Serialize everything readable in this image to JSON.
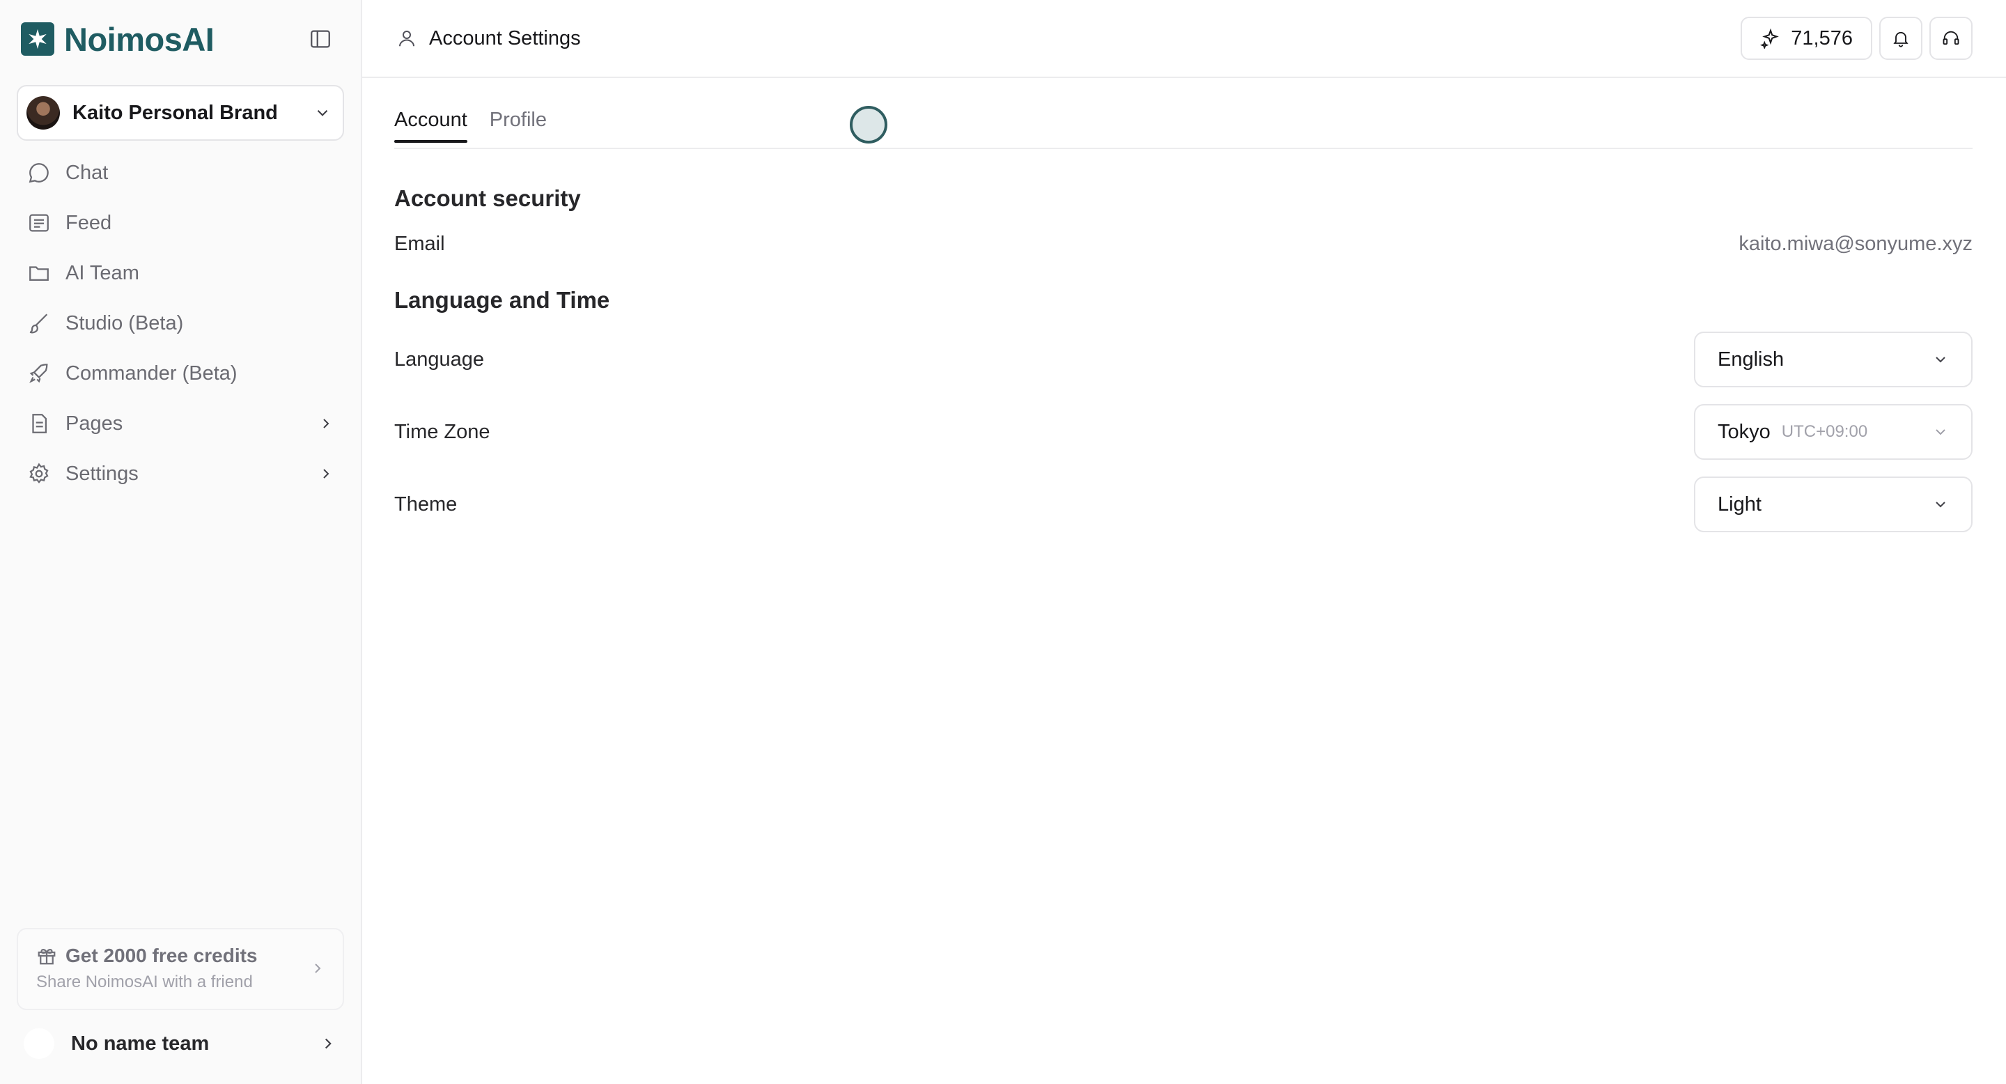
{
  "app": {
    "name": "NoimosAI"
  },
  "sidebar": {
    "workspace": {
      "name": "Kaito Personal Brand"
    },
    "items": [
      {
        "label": "Chat",
        "icon": "chat-bubble-icon"
      },
      {
        "label": "Feed",
        "icon": "list-icon"
      },
      {
        "label": "AI Team",
        "icon": "folder-icon"
      },
      {
        "label": "Studio (Beta)",
        "icon": "brush-icon"
      },
      {
        "label": "Commander (Beta)",
        "icon": "rocket-icon"
      },
      {
        "label": "Pages",
        "icon": "document-icon"
      },
      {
        "label": "Settings",
        "icon": "gear-icon"
      }
    ],
    "promo": {
      "title": "Get 2000 free credits",
      "subtitle": "Share NoimosAI with a friend"
    },
    "team": {
      "name": "No name team"
    }
  },
  "header": {
    "title": "Account Settings",
    "credits": "71,576"
  },
  "tabs": [
    {
      "label": "Account",
      "active": true
    },
    {
      "label": "Profile",
      "active": false
    }
  ],
  "account_security": {
    "title": "Account security",
    "email_label": "Email",
    "email_value": "kaito.miwa@sonyume.xyz"
  },
  "language_time": {
    "title": "Language and Time",
    "language_label": "Language",
    "language_value": "English",
    "timezone_label": "Time Zone",
    "timezone_value": "Tokyo",
    "timezone_offset": "UTC+09:00",
    "theme_label": "Theme",
    "theme_value": "Light"
  },
  "colors": {
    "brand": "#1f5c62",
    "border": "#e4e4e7",
    "sidebar_bg": "#fafafa"
  }
}
